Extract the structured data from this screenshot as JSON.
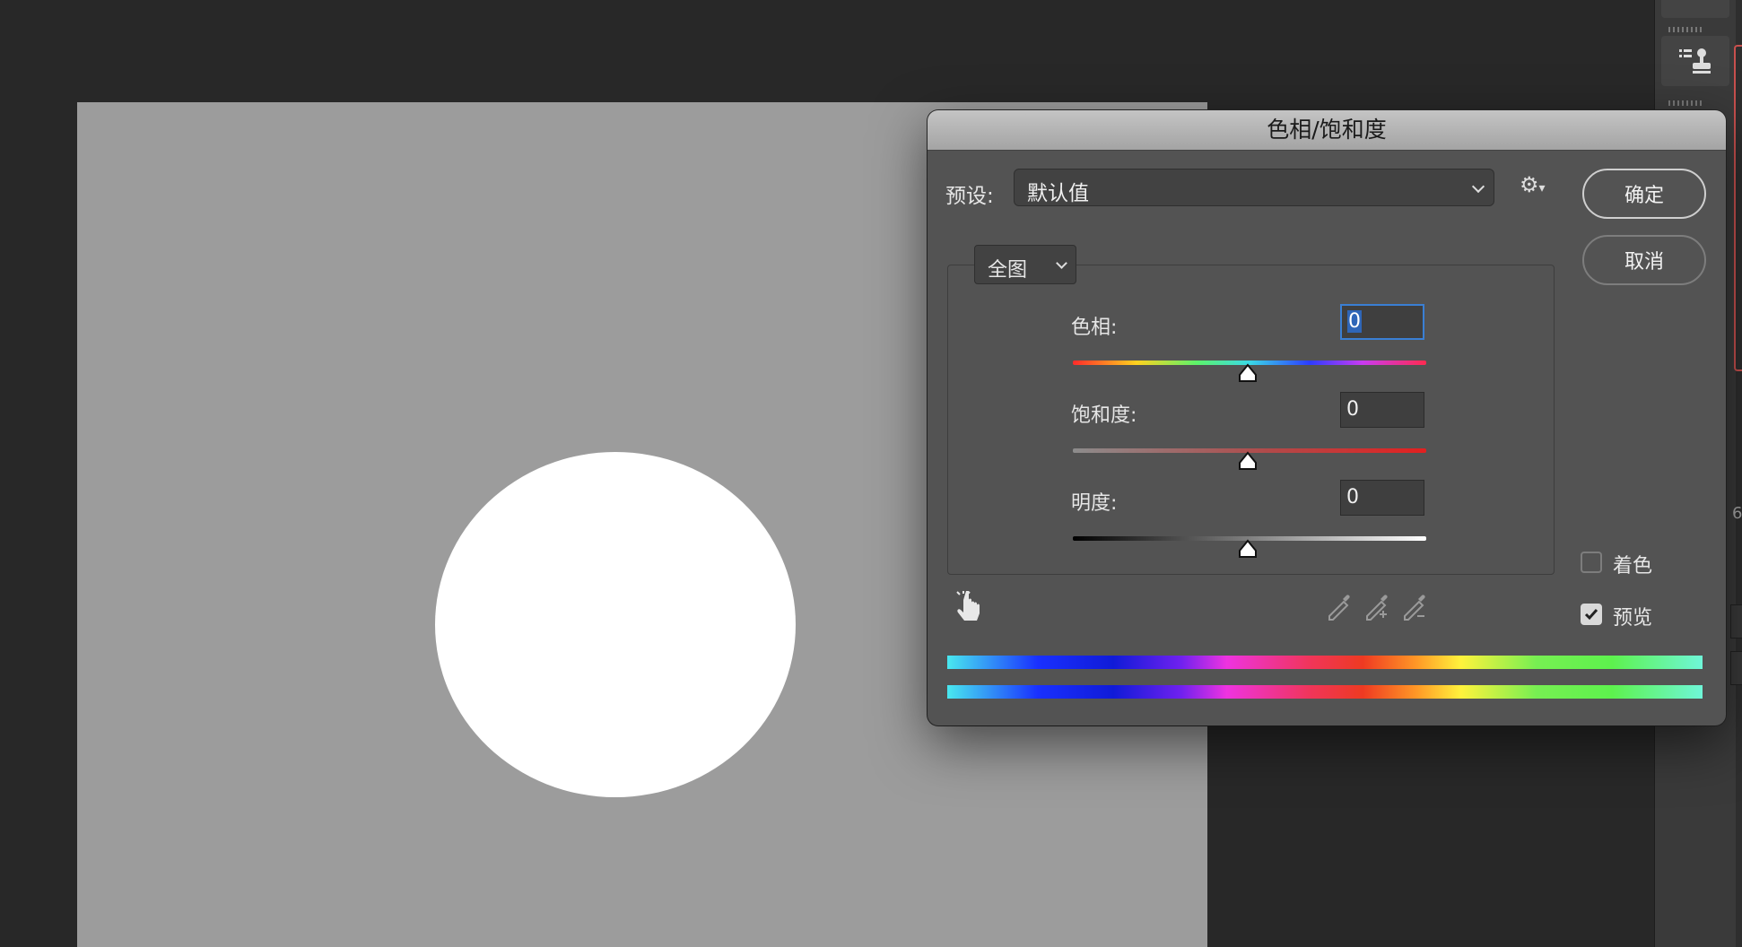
{
  "dialog": {
    "title": "色相/饱和度",
    "preset_label": "预设:",
    "preset_value": "默认值",
    "ok_label": "确定",
    "cancel_label": "取消",
    "channel_value": "全图",
    "sliders": [
      {
        "label": "色相:",
        "value": "0"
      },
      {
        "label": "饱和度:",
        "value": "0"
      },
      {
        "label": "明度:",
        "value": "0"
      }
    ],
    "colorize_label": "着色",
    "colorize_checked": false,
    "preview_label": "预览",
    "preview_checked": true
  },
  "right_panel": {
    "edge_digit": "6"
  },
  "colors": {
    "canvas": "#9c9c9c",
    "workspace": "#282828",
    "dialog_bg": "#535353",
    "focus_accent": "#3a7fd4",
    "layer_highlight": "#c8504e"
  }
}
